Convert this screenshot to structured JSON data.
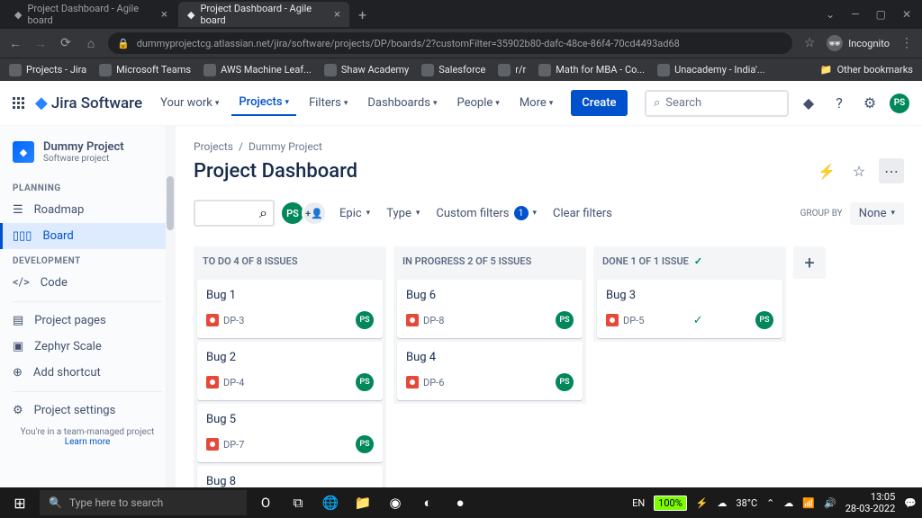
{
  "browser": {
    "tabs": [
      {
        "title": "Project Dashboard - Agile board",
        "active": false
      },
      {
        "title": "Project Dashboard - Agile board",
        "active": true
      }
    ],
    "url": "dummyprojectcg.atlassian.net/jira/software/projects/DP/boards/2?customFilter=35902b80-dafc-48ce-86f4-70cd4493ad68",
    "incognito_label": "Incognito",
    "bookmarks": [
      "Projects - Jira",
      "Microsoft Teams",
      "AWS Machine Leaf...",
      "Shaw Academy",
      "Salesforce",
      "r/r",
      "Math for MBA - Co...",
      "Unacademy - India'..."
    ],
    "other_bookmarks": "Other bookmarks"
  },
  "nav": {
    "product": "Jira Software",
    "items": [
      "Your work",
      "Projects",
      "Filters",
      "Dashboards",
      "People",
      "More"
    ],
    "create": "Create",
    "search_placeholder": "Search",
    "avatar": "PS"
  },
  "sidebar": {
    "project_name": "Dummy Project",
    "project_type": "Software project",
    "section_planning": "PLANNING",
    "section_development": "DEVELOPMENT",
    "roadmap": "Roadmap",
    "board": "Board",
    "code": "Code",
    "project_pages": "Project pages",
    "zephyr": "Zephyr Scale",
    "add_shortcut": "Add shortcut",
    "project_settings": "Project settings",
    "footer_text": "You're in a team-managed project",
    "footer_link": "Learn more"
  },
  "content": {
    "breadcrumb": [
      "Projects",
      "Dummy Project"
    ],
    "title": "Project Dashboard",
    "filters": {
      "epic": "Epic",
      "type": "Type",
      "custom": "Custom filters",
      "custom_count": "1",
      "clear": "Clear filters",
      "group_by_label": "GROUP BY",
      "group_by_value": "None"
    },
    "columns": [
      {
        "header": "TO DO 4 OF 8 ISSUES",
        "done": false,
        "cards": [
          {
            "title": "Bug 1",
            "key": "DP-3",
            "avatar": "PS"
          },
          {
            "title": "Bug 2",
            "key": "DP-4",
            "avatar": "PS"
          },
          {
            "title": "Bug 5",
            "key": "DP-7",
            "avatar": "PS"
          },
          {
            "title": "Bug 8",
            "key": "",
            "avatar": ""
          }
        ]
      },
      {
        "header": "IN PROGRESS 2 OF 5 ISSUES",
        "done": false,
        "cards": [
          {
            "title": "Bug 6",
            "key": "DP-8",
            "avatar": "PS"
          },
          {
            "title": "Bug 4",
            "key": "DP-6",
            "avatar": "PS"
          }
        ]
      },
      {
        "header": "DONE 1 OF 1 ISSUE",
        "done": true,
        "cards": [
          {
            "title": "Bug 3",
            "key": "DP-5",
            "avatar": "PS",
            "done": true
          }
        ]
      }
    ]
  },
  "taskbar": {
    "search_placeholder": "Type here to search",
    "lang": "EN",
    "battery": "100%",
    "temp": "38°C",
    "time": "13:05",
    "date": "28-03-2022"
  }
}
